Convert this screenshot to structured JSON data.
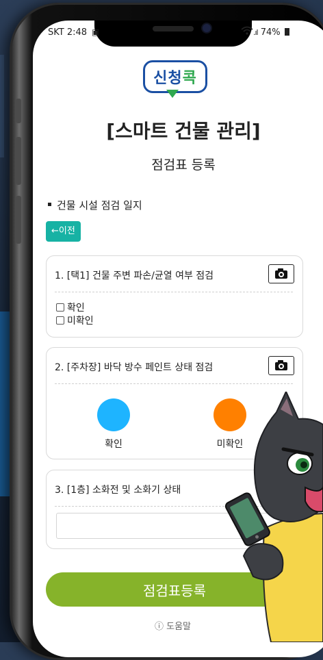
{
  "status": {
    "carrier_time": "SKT 2:48",
    "signal_battery": "74%"
  },
  "logo": {
    "part1": "신청",
    "part2": "콕"
  },
  "header": {
    "title": "[스마트 건물 관리]",
    "subtitle": "점검표 등록"
  },
  "section": {
    "title": "건물 시설 점검 일지"
  },
  "back_button": "←이전",
  "items": [
    {
      "title": "1. [택1] 건물 주변 파손/균열 여부 점검",
      "options": [
        "확인",
        "미확인"
      ]
    },
    {
      "title": "2. [주차장] 바닥 방수 페인트 상태 점검",
      "options": [
        "확인",
        "미확인"
      ],
      "colors": [
        "#1eb4ff",
        "#ff8000"
      ]
    },
    {
      "title": "3. [1층] 소화전 및 소화기 상태",
      "input_value": ""
    }
  ],
  "submit_button": "점검표등록",
  "help": "ⓘ 도움말",
  "colors": {
    "accent_teal": "#17b2a4",
    "submit_green": "#86b32a",
    "logo_blue": "#1a4fa3",
    "logo_green": "#2fa84f"
  }
}
